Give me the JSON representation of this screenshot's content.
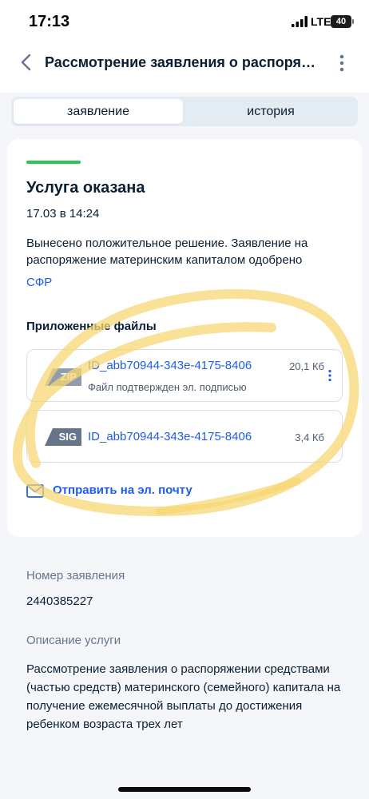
{
  "status_bar": {
    "time": "17:13",
    "network": "LTE",
    "battery": "40"
  },
  "header": {
    "title": "Рассмотрение заявления о распоряжении",
    "back_icon": "chevron-left-icon",
    "more_icon": "vertical-dots-icon"
  },
  "tabs": [
    {
      "label": "заявление",
      "active": true
    },
    {
      "label": "история",
      "active": false
    }
  ],
  "card": {
    "status_title": "Услуга оказана",
    "status_color": "#2ec450",
    "date": "17.03 в 14:24",
    "description": "Вынесено положительное решение. Заявление на распоряжение материнским капиталом одобрено",
    "organization": "СФР",
    "files_title": "Приложенные файлы",
    "files": [
      {
        "badge": "ZIP",
        "name": "ID_abb70944-343e-4175-8406",
        "size": "20,1 Кб",
        "subtitle": "Файл подтвержден эл. подписью"
      },
      {
        "badge": "SIG",
        "name": "ID_abb70944-343e-4175-8406",
        "size": "3,4 Кб"
      }
    ],
    "send_label": "Отправить на эл. почту",
    "send_icon": "envelope-icon"
  },
  "info": {
    "number_label": "Номер заявления",
    "number_value": "2440385227",
    "service_label": "Описание услуги",
    "service_value": "Рассмотрение заявления о распоряжении средствами (частью средств) материнского (семейного) капитала на получение ежемесячной выплаты до достижения ребенком возраста трех лет"
  },
  "colors": {
    "accent": "#1d5deb",
    "text": "#0b1f33",
    "muted": "#66768a",
    "background": "#f4f6f9",
    "highlight": "#f7d774"
  }
}
